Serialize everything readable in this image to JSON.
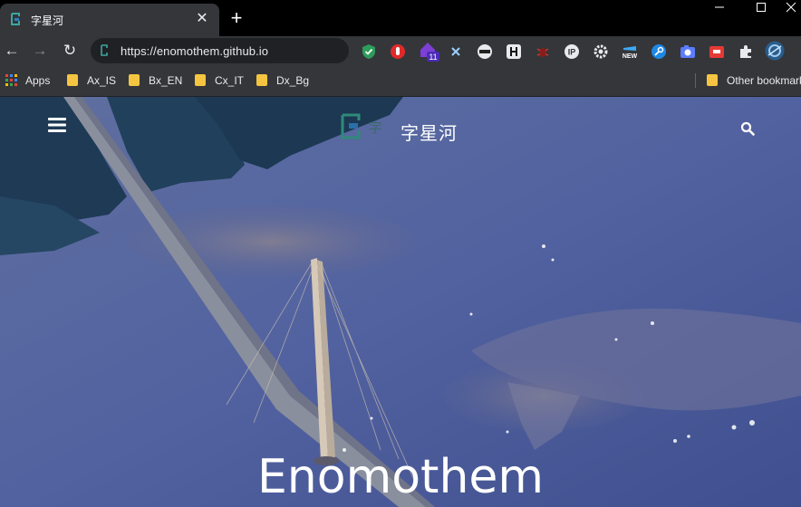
{
  "browser": {
    "tab": {
      "title": "字星河",
      "close_glyph": "✕",
      "favicon": "site-favicon-icon"
    },
    "new_tab_glyph": "+",
    "window_controls": {
      "minimize": "—",
      "maximize": "☐",
      "close": "✕"
    },
    "nav": {
      "back": "←",
      "forward": "→",
      "reload": "↻"
    },
    "address": {
      "url": "https://enomothem.github.io"
    },
    "extensions": [
      "shield-check-icon",
      "red-hand-icon",
      "purple-house-icon",
      "x-icon",
      "ninja-icon",
      "h-icon",
      "bug-icon",
      "ip-icon",
      "gear-icon",
      "new-icon",
      "key-icon",
      "camera-icon",
      "red-box-icon",
      "puzzle-icon",
      "avatar-icon"
    ],
    "extension_badge": "11"
  },
  "bookmarks": {
    "apps_label": "Apps",
    "items": [
      {
        "label": "Ax_IS"
      },
      {
        "label": "Bx_EN"
      },
      {
        "label": "Cx_IT"
      },
      {
        "label": "Dx_Bg"
      }
    ],
    "other_label": "Other bookmarks"
  },
  "site": {
    "title": "字星河",
    "logo_char": "字",
    "hero_heading": "Enomothem"
  }
}
